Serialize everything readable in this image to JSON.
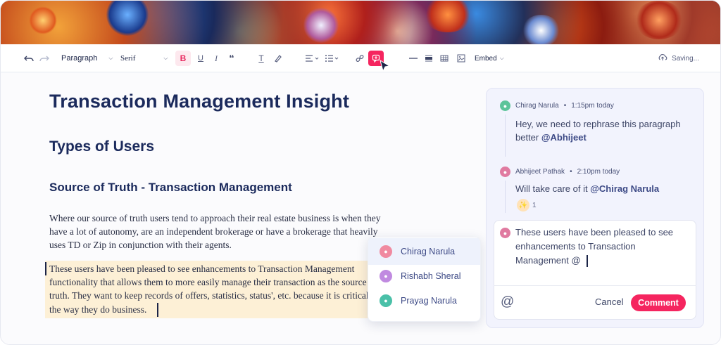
{
  "toolbar": {
    "paragraph_select": "Paragraph",
    "font_select": "Serif",
    "embed_label": "Embed",
    "saving_label": "Saving..."
  },
  "document": {
    "title": "Transaction Management Insight",
    "heading2": "Types of Users",
    "heading3": "Source of Truth - Transaction Management",
    "paragraph1": "Where our source of truth users tend to approach their real estate business is when they have a lot of autonomy, are an independent brokerage or have a brokerage that heavily uses TD or Zip in conjunction with their agents.",
    "highlighted_paragraph": "These users have been pleased to see enhancements to Transaction Management functionality that allows them to more easily manage their transaction as the source of truth. They want to keep records of offers, statistics, status', etc. because it is critical to the way they do business."
  },
  "mention_popup": {
    "items": [
      {
        "name": "Chirag Narula"
      },
      {
        "name": "Rishabh Sheral"
      },
      {
        "name": "Prayag Narula"
      }
    ]
  },
  "comments": {
    "thread": [
      {
        "author": "Chirag Narula",
        "time": "1:15pm today",
        "text_before": "Hey, we need to rephrase this paragraph better ",
        "mention": "@Abhijeet"
      },
      {
        "author": "Abhijeet Pathak",
        "time": "2:10pm today",
        "text_before": "Will take care of it ",
        "mention": "@Chirag Narula",
        "reaction_count": "1"
      }
    ],
    "reply_text": "These users have been pleased to see enhancements to Transaction Management @",
    "cancel_label": "Cancel",
    "comment_label": "Comment"
  },
  "colors": {
    "accent": "#f5255f",
    "heading": "#1b2a5c",
    "highlight": "#fdf0d6",
    "panel": "#f2f3fd"
  }
}
